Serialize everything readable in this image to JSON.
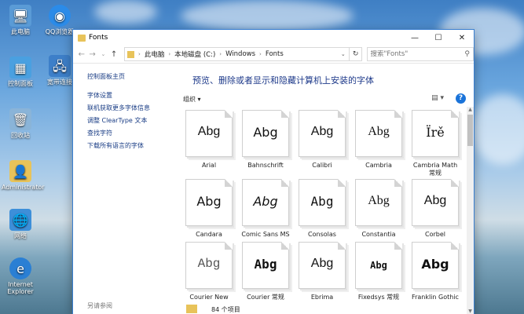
{
  "desktop": {
    "icons": [
      {
        "label": "此电脑",
        "icon": "computer-icon",
        "color": "#5a9bd6"
      },
      {
        "label": "QQ浏览器",
        "icon": "browser-icon",
        "color": "#2b8be8"
      },
      {
        "label": "控制面板",
        "icon": "control-panel-icon",
        "color": "#4aa0e0"
      },
      {
        "label": "宽带连接",
        "icon": "network-icon",
        "color": "#3d7fc9"
      },
      {
        "label": "回收站",
        "icon": "recycle-bin-icon",
        "color": "#8ab4d8"
      },
      {
        "label": "Administrator",
        "icon": "user-folder-icon",
        "color": "#e8c35a"
      },
      {
        "label": "网络",
        "icon": "network-globe-icon",
        "color": "#3d8fd9"
      },
      {
        "label": "Internet Explorer",
        "icon": "ie-icon",
        "color": "#2a7fd4"
      }
    ]
  },
  "window": {
    "title": "Fonts",
    "minimize": "—",
    "maximize": "☐",
    "close": "✕",
    "path": [
      "此电脑",
      "本地磁盘 (C:)",
      "Windows",
      "Fonts"
    ],
    "search_placeholder": "搜索\"Fonts\""
  },
  "sidebar": {
    "links": [
      "控制面板主页",
      "字体设置",
      "联机获取更多字体信息",
      "调整 ClearType 文本",
      "查找字符",
      "下载所有语言的字体"
    ],
    "see_also": "另请参阅"
  },
  "main": {
    "heading": "预览、删除或者显示和隐藏计算机上安装的字体",
    "organize": "组织 ▾",
    "help": "?",
    "fonts": [
      {
        "preview": "Abg",
        "name": "Arial"
      },
      {
        "preview": "Abg",
        "name": "Bahnschrift"
      },
      {
        "preview": "Abg",
        "name": "Calibri"
      },
      {
        "preview": "Abg",
        "name": "Cambria"
      },
      {
        "preview": "Ïrě",
        "name": "Cambria Math 常规"
      },
      {
        "preview": "Abg",
        "name": "Candara"
      },
      {
        "preview": "Abg",
        "name": "Comic Sans MS"
      },
      {
        "preview": "Abg",
        "name": "Consolas"
      },
      {
        "preview": "Abg",
        "name": "Constantia"
      },
      {
        "preview": "Abg",
        "name": "Corbel"
      },
      {
        "preview": "Abg",
        "name": "Courier New"
      },
      {
        "preview": "Abg",
        "name": "Courier 常规"
      },
      {
        "preview": "Abg",
        "name": "Ebrima"
      },
      {
        "preview": "Abg",
        "name": "Fixedsys 常规"
      },
      {
        "preview": "Abg",
        "name": "Franklin Gothic"
      }
    ]
  },
  "status": {
    "count": "84 个项目"
  }
}
